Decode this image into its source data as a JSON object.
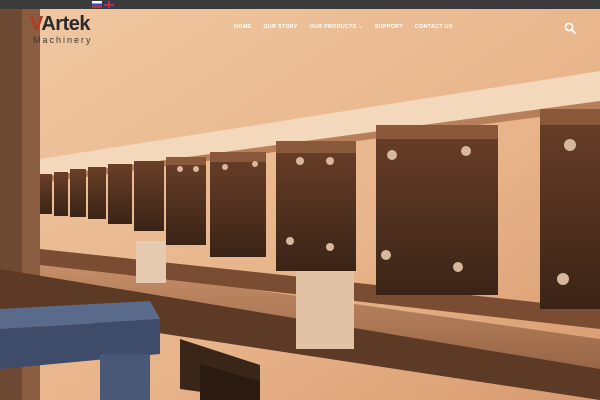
{
  "language_bar": {
    "flags": [
      {
        "lang": "ru",
        "icon": "russia-flag-icon"
      },
      {
        "lang": "en",
        "icon": "uk-flag-icon"
      }
    ]
  },
  "logo": {
    "brand_accent": "V",
    "brand_rest": "Artek",
    "subtitle": "Machinery",
    "accent_color": "#b63a1e"
  },
  "nav": {
    "items": [
      {
        "label": "HOME"
      },
      {
        "label": "OUR STORY"
      },
      {
        "label": "OUR PRODUCTS",
        "has_dropdown": true
      },
      {
        "label": "SUPPORT"
      },
      {
        "label": "CONTACT US"
      }
    ],
    "search_icon": "search-icon"
  },
  "hero": {
    "description": "",
    "overlay_color": "#e8a878"
  }
}
